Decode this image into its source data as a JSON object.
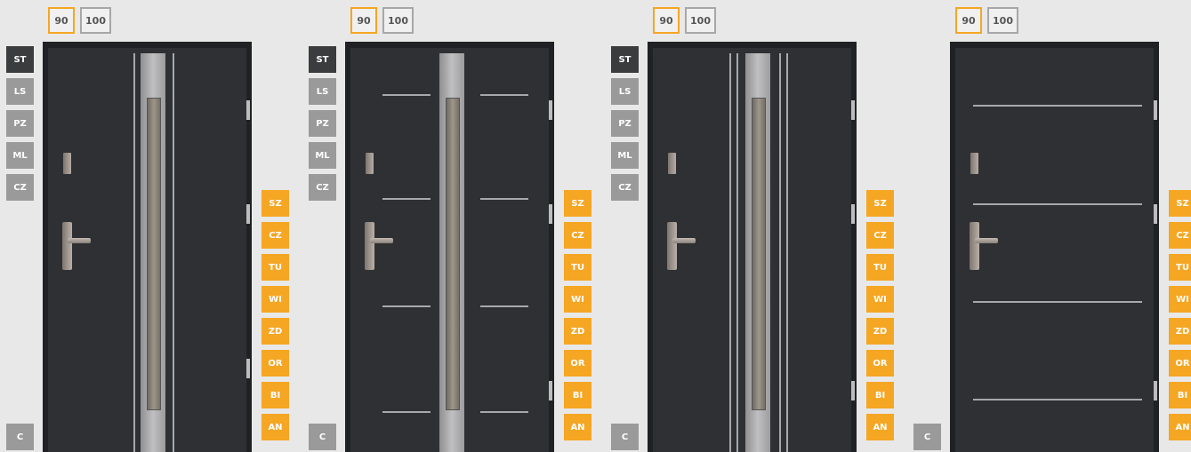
{
  "colors": {
    "accent": "#f5a623",
    "selected_side": "#3b3c3e",
    "side": "#9a9a9a",
    "door": "#2f3033"
  },
  "size_options": [
    "90",
    "100"
  ],
  "side_options": [
    "ST",
    "LS",
    "PZ",
    "ML",
    "CZ"
  ],
  "corner_label": "C",
  "color_options": [
    "SZ",
    "CZ",
    "TU",
    "WI",
    "ZD",
    "OR",
    "BI",
    "AN"
  ]
}
